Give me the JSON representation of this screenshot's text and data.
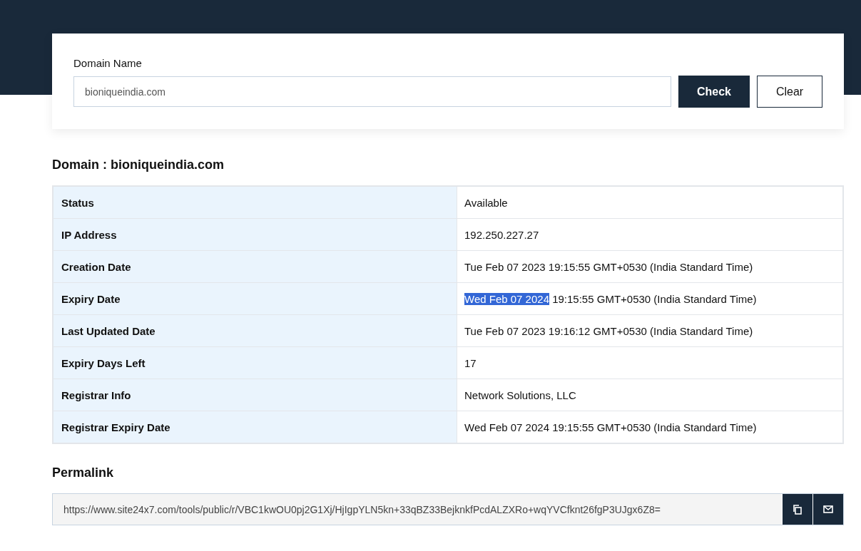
{
  "search": {
    "label": "Domain Name",
    "value": "bioniqueindia.com",
    "buttons": [
      {
        "label": "Check",
        "kind": "primary"
      },
      {
        "label": "Clear",
        "kind": "secondary"
      }
    ]
  },
  "result": {
    "title": "Domain : bioniqueindia.com",
    "rows": [
      {
        "label": "Status",
        "value": "Available"
      },
      {
        "label": "IP Address",
        "value": "192.250.227.27"
      },
      {
        "label": "Creation Date",
        "value": "Tue Feb 07 2023 19:15:55 GMT+0530 (India Standard Time)"
      },
      {
        "label": "Expiry Date",
        "selection": "Wed Feb 07 2024",
        "value": "19:15:55 GMT+0530 (India Standard Time)"
      },
      {
        "label": "Last Updated Date",
        "value": "Tue Feb 07 2023 19:16:12 GMT+0530 (India Standard Time)"
      },
      {
        "label": "Expiry Days Left",
        "value": "17"
      },
      {
        "label": "Registrar Info",
        "value": "Network Solutions, LLC"
      },
      {
        "label": "Registrar Expiry Date",
        "value": "Wed Feb 07 2024 19:15:55 GMT+0530 (India Standard Time)"
      }
    ]
  },
  "permalink": {
    "title": "Permalink",
    "url": "https://www.site24x7.com/tools/public/r/VBC1kwOU0pj2G1Xj/HjIgpYLN5kn+33qBZ33BejknkfPcdALZXRo+wqYVCfknt26fgP3UJgx6Z8="
  }
}
